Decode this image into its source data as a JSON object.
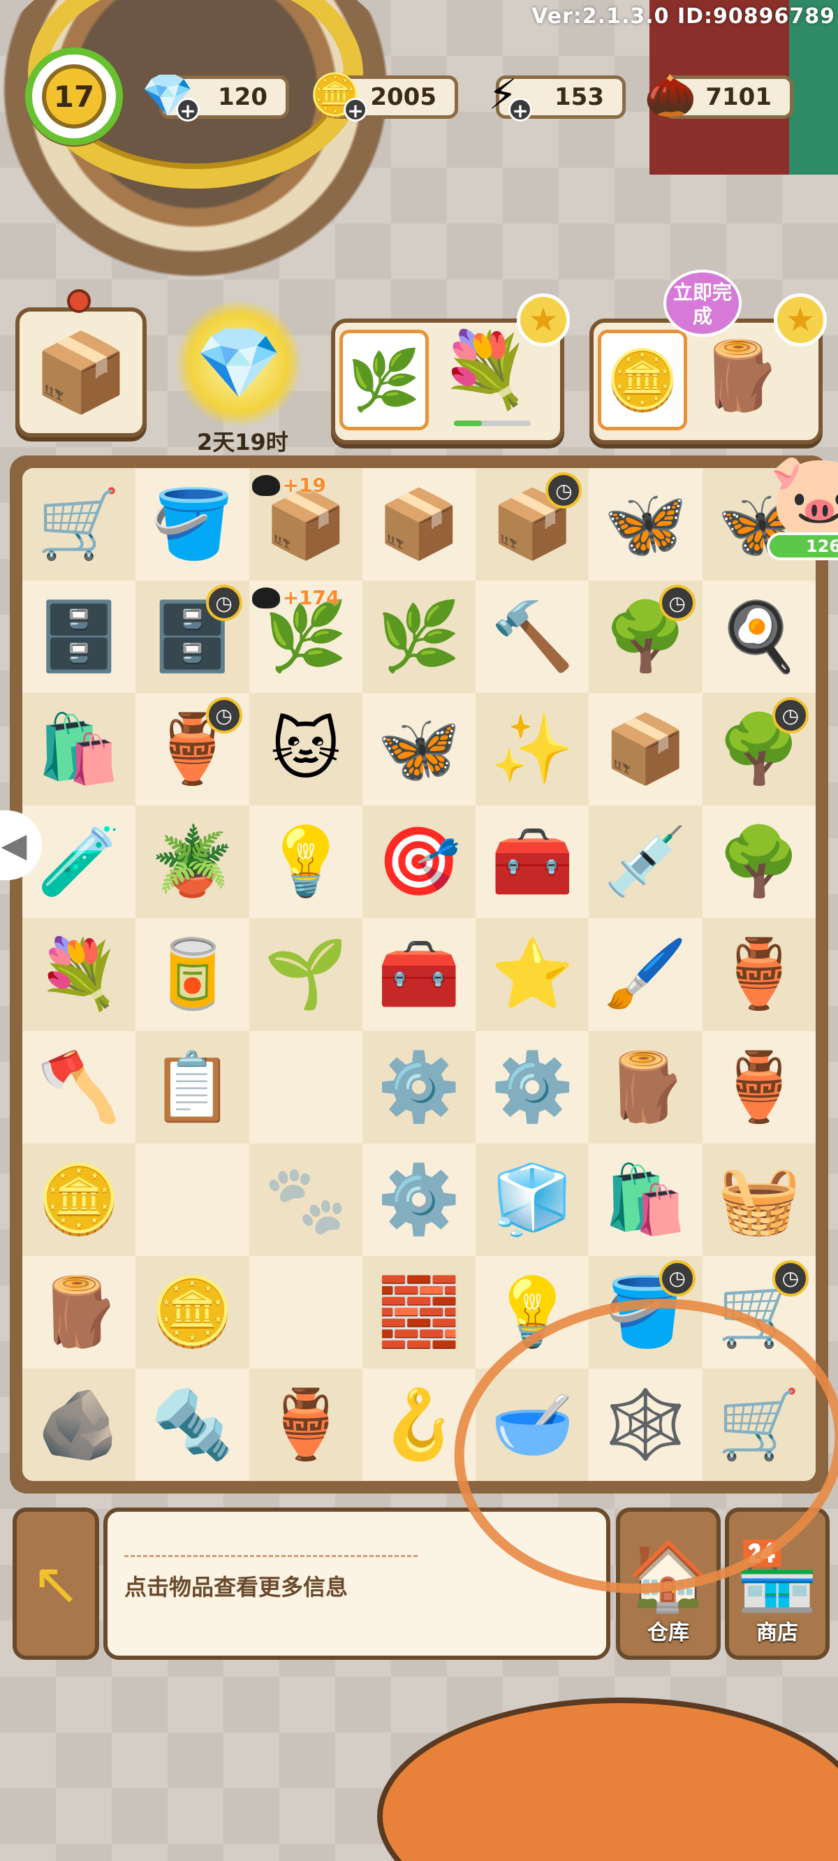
{
  "version": "Ver:2.1.3.0 ID:90896789",
  "player": {
    "level": "17"
  },
  "resources": [
    {
      "name": "gems",
      "icon": "💎",
      "value": "120"
    },
    {
      "name": "coins",
      "icon": "🪙",
      "value": "2005"
    },
    {
      "name": "energy",
      "icon": "⚡",
      "value": "153"
    },
    {
      "name": "seeds",
      "icon": "🌰",
      "value": "7101"
    }
  ],
  "top_cards": {
    "gem_timer": "2天19时",
    "instant_complete": "立即完成"
  },
  "side_progress": {
    "text": "126/",
    "fraction": 0.9
  },
  "board": {
    "rows": [
      [
        {
          "icon": "🛒",
          "clock": false
        },
        {
          "icon": "🪣",
          "clock": false
        },
        {
          "icon": "📦",
          "bonus": "+19"
        },
        {
          "icon": "📦",
          "clock": false
        },
        {
          "icon": "📦",
          "clock": true
        },
        {
          "icon": "🦋",
          "clock": false
        },
        {
          "icon": "🦋",
          "clock": false
        }
      ],
      [
        {
          "icon": "🗄️",
          "clock": false
        },
        {
          "icon": "🗄️",
          "clock": true
        },
        {
          "icon": "🌿",
          "bonus": "+174"
        },
        {
          "icon": "🌿",
          "clock": false
        },
        {
          "icon": "🔨",
          "clock": false
        },
        {
          "icon": "🌳",
          "clock": true
        },
        {
          "icon": "🍳",
          "clock": false
        }
      ],
      [
        {
          "icon": "🛍️",
          "clock": false
        },
        {
          "icon": "🏺",
          "clock": true
        },
        {
          "icon": "🐱",
          "clock": false
        },
        {
          "icon": "🦋",
          "clock": false
        },
        {
          "icon": "✨",
          "clock": false
        },
        {
          "icon": "📦",
          "clock": false
        },
        {
          "icon": "🌳",
          "clock": true
        }
      ],
      [
        {
          "icon": "🧪",
          "clock": false
        },
        {
          "icon": "🪴",
          "clock": false
        },
        {
          "icon": "💡",
          "clock": false
        },
        {
          "icon": "🎯",
          "clock": false
        },
        {
          "icon": "🧰",
          "clock": false
        },
        {
          "icon": "💉",
          "clock": false
        },
        {
          "icon": "🌳",
          "clock": false
        }
      ],
      [
        {
          "icon": "💐",
          "clock": false
        },
        {
          "icon": "🥫",
          "clock": false
        },
        {
          "icon": "🌱",
          "clock": false
        },
        {
          "icon": "🧰",
          "clock": false
        },
        {
          "icon": "⭐",
          "clock": false
        },
        {
          "icon": "🖌️",
          "clock": false
        },
        {
          "icon": "🏺",
          "clock": false
        }
      ],
      [
        {
          "icon": "🪓",
          "clock": false
        },
        {
          "icon": "📋",
          "clock": false
        },
        {
          "icon": "",
          "clock": false
        },
        {
          "icon": "⚙️",
          "clock": false
        },
        {
          "icon": "⚙️",
          "clock": false
        },
        {
          "icon": "🪵",
          "clock": false
        },
        {
          "icon": "🏺",
          "clock": false
        }
      ],
      [
        {
          "icon": "🪙",
          "clock": false
        },
        {
          "icon": "",
          "clock": false
        },
        {
          "icon": "🐾",
          "clock": false
        },
        {
          "icon": "⚙️",
          "clock": false
        },
        {
          "icon": "🧊",
          "clock": false
        },
        {
          "icon": "🛍️",
          "clock": false
        },
        {
          "icon": "🧺",
          "clock": false
        }
      ],
      [
        {
          "icon": "🪵",
          "clock": false
        },
        {
          "icon": "🪙",
          "clock": false
        },
        {
          "icon": "",
          "clock": false
        },
        {
          "icon": "🧱",
          "clock": false
        },
        {
          "icon": "💡",
          "clock": false
        },
        {
          "icon": "🪣",
          "clock": true
        },
        {
          "icon": "🛒",
          "clock": true
        }
      ],
      [
        {
          "icon": "🪨",
          "clock": false
        },
        {
          "icon": "🔩",
          "clock": false
        },
        {
          "icon": "🏺",
          "clock": false
        },
        {
          "icon": "🪝",
          "clock": false
        },
        {
          "icon": "🥣",
          "clock": false
        },
        {
          "icon": "🕸️",
          "clock": false
        },
        {
          "icon": "🛒",
          "clock": false
        }
      ]
    ]
  },
  "info_panel": {
    "text": "点击物品查看更多信息"
  },
  "nav": {
    "back_icon": "↖",
    "warehouse": {
      "icon": "🏠",
      "label": "仓库"
    },
    "shop": {
      "icon": "🏪",
      "label": "商店"
    }
  },
  "colors": {
    "board_frame": "#8b6440",
    "annotation_circle": "#e88a45"
  }
}
